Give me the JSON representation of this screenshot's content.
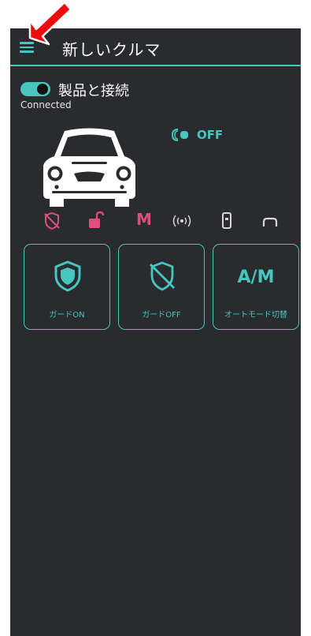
{
  "header": {
    "title": "新しいクルマ",
    "menu_icon": "hamburger-menu-icon"
  },
  "connection": {
    "label": "製品と接続",
    "enabled": true,
    "status": "Connected"
  },
  "engine": {
    "status": "OFF"
  },
  "status_icons": [
    {
      "name": "guard-off-icon",
      "color": "#e04f7b"
    },
    {
      "name": "unlocked-icon",
      "color": "#e04f7b"
    },
    {
      "name": "manual-mode-icon",
      "label": "M",
      "color": "#e04f7b"
    },
    {
      "name": "signal-icon",
      "color": "#d8d8d8"
    },
    {
      "name": "remote-icon",
      "color": "#d8d8d8"
    },
    {
      "name": "car-front-icon",
      "color": "#d8d8d8"
    }
  ],
  "actions": [
    {
      "label": "ガードON"
    },
    {
      "label": "ガードOFF"
    },
    {
      "label": "オートモード切替",
      "icon_text": "A/M"
    }
  ],
  "colors": {
    "accent": "#47c6c0",
    "alert": "#e04f7b",
    "background": "#2a2b2f",
    "arrow": "#ef0b0b"
  }
}
